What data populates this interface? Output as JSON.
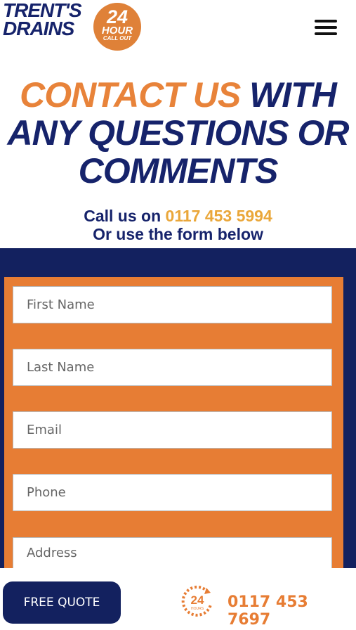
{
  "header": {
    "logo_line1": "TRENT'S",
    "logo_line2": "DRAINS",
    "badge_number": "24",
    "badge_word": "HOUR",
    "badge_sub": "CALL OUT"
  },
  "hero": {
    "title_accent": "CONTACT US",
    "title_rest": " WITH ANY QUESTIONS OR COMMENTS",
    "call_prefix": "Call us on ",
    "call_phone": "0117 453 5994",
    "form_hint": "Or use the form below"
  },
  "form": {
    "first_name_placeholder": "First Name",
    "last_name_placeholder": "Last Name",
    "email_placeholder": "Email",
    "phone_placeholder": "Phone",
    "address_placeholder": "Address"
  },
  "bottom_bar": {
    "quote_label": "FREE QUOTE",
    "icon_number": "24",
    "icon_word": "HOURS",
    "phone": "0117 453 7697"
  },
  "colors": {
    "navy": "#13215f",
    "orange": "#e77d34",
    "gold": "#eaa73a"
  }
}
